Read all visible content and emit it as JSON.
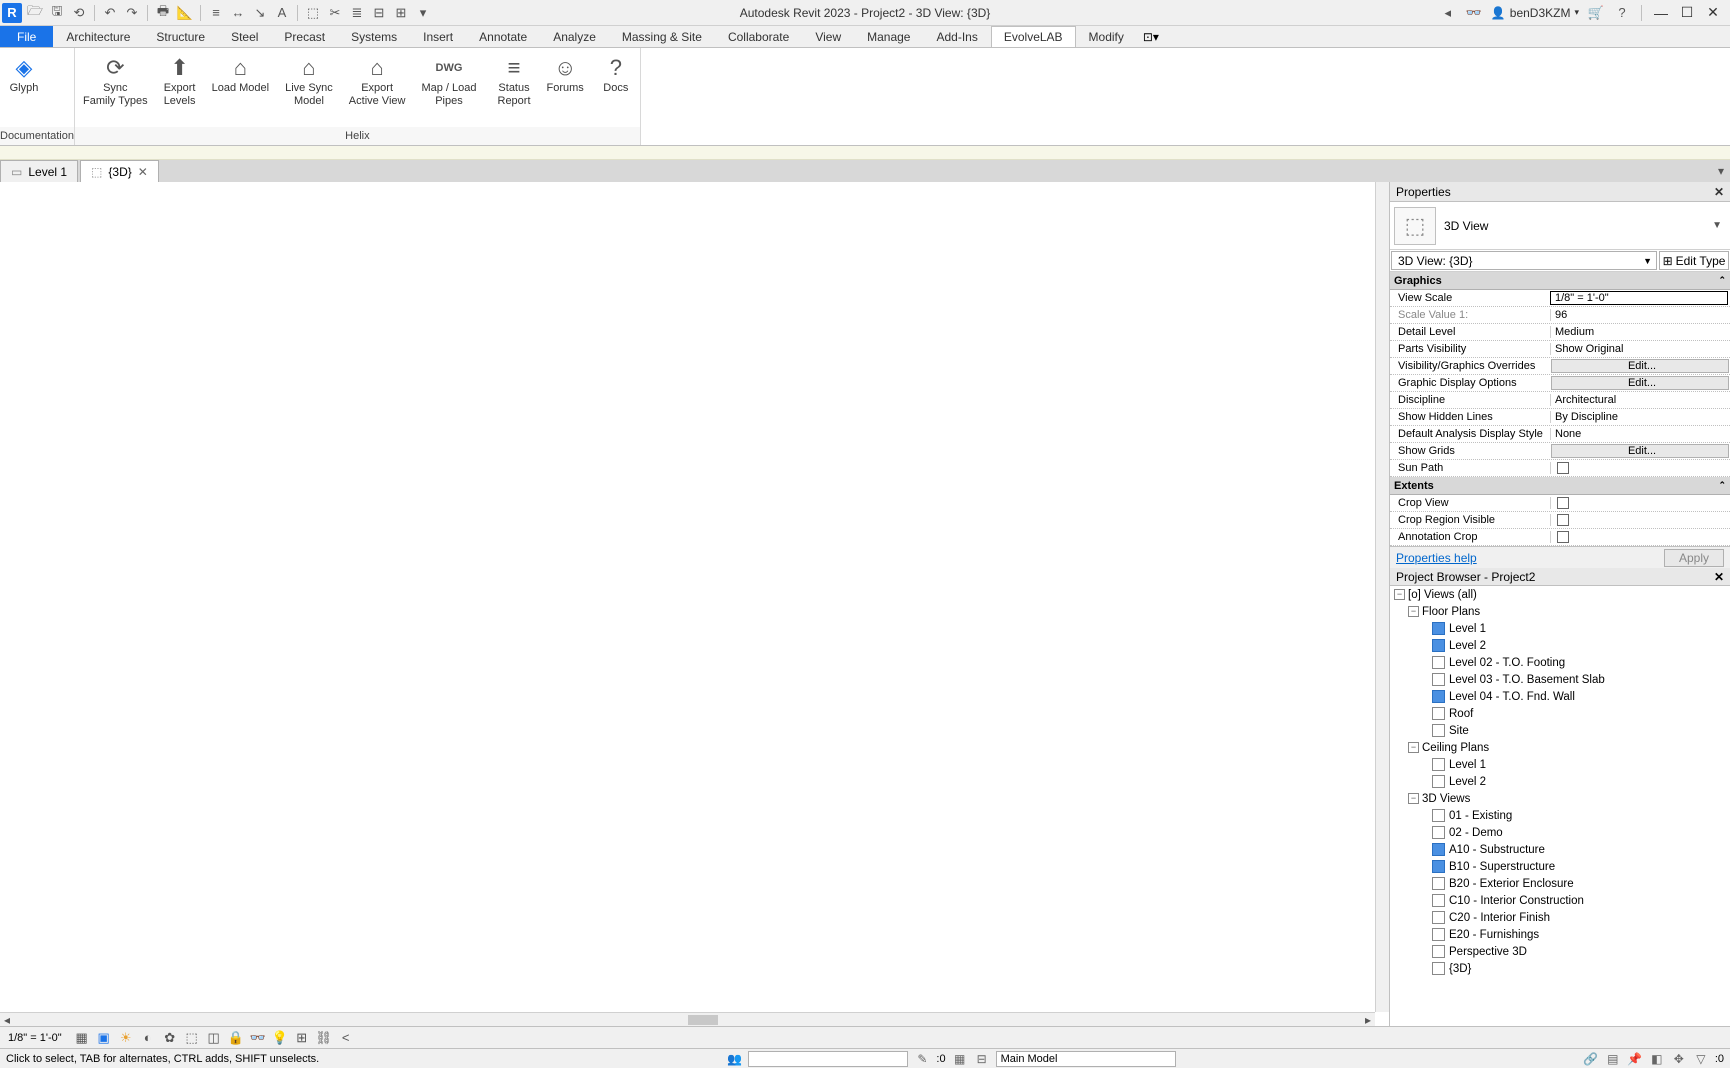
{
  "titlebar": {
    "app_title": "Autodesk Revit 2023 - Project2 - 3D View: {3D}",
    "username": "benD3KZM",
    "logo": "R"
  },
  "ribbon_tabs": {
    "file": "File",
    "items": [
      "Architecture",
      "Structure",
      "Steel",
      "Precast",
      "Systems",
      "Insert",
      "Annotate",
      "Analyze",
      "Massing & Site",
      "Collaborate",
      "View",
      "Manage",
      "Add-Ins",
      "EvolveLAB",
      "Modify"
    ],
    "active": "EvolveLAB"
  },
  "ribbon": {
    "panel1": {
      "label": "Documentation",
      "buttons": [
        {
          "lbl": "Glyph",
          "ico": "◈"
        }
      ]
    },
    "panel2": {
      "label": "",
      "buttons": [
        {
          "lbl": "Sync\nFamily Types",
          "ico": "⟳"
        },
        {
          "lbl": "Export\nLevels",
          "ico": "⬆"
        },
        {
          "lbl": "Load Model",
          "ico": "⌂"
        },
        {
          "lbl": "Live Sync\nModel",
          "ico": "⌂"
        },
        {
          "lbl": "Export\nActive View",
          "ico": "⌂"
        },
        {
          "lbl": "Map / Load\nPipes",
          "ico": "DWG"
        },
        {
          "lbl": "Status\nReport",
          "ico": "≡"
        },
        {
          "lbl": "Forums",
          "ico": "☺"
        },
        {
          "lbl": "Docs",
          "ico": "?"
        }
      ],
      "sublabel": "Helix"
    }
  },
  "view_tabs": {
    "tab1": "Level 1",
    "tab2": "{3D}"
  },
  "properties": {
    "title": "Properties",
    "type_name": "3D View",
    "selector": "3D View: {3D}",
    "edit_type": "Edit Type",
    "groups": {
      "graphics": "Graphics",
      "extents": "Extents"
    },
    "rows": {
      "view_scale": {
        "k": "View Scale",
        "v": "1/8\" = 1'-0\""
      },
      "scale_value": {
        "k": "Scale Value    1:",
        "v": "96"
      },
      "detail_level": {
        "k": "Detail Level",
        "v": "Medium"
      },
      "parts_vis": {
        "k": "Parts Visibility",
        "v": "Show Original"
      },
      "vg": {
        "k": "Visibility/Graphics Overrides",
        "v": "Edit..."
      },
      "gdo": {
        "k": "Graphic Display Options",
        "v": "Edit..."
      },
      "discipline": {
        "k": "Discipline",
        "v": "Architectural"
      },
      "hidden": {
        "k": "Show Hidden Lines",
        "v": "By Discipline"
      },
      "analysis": {
        "k": "Default Analysis Display Style",
        "v": "None"
      },
      "grids": {
        "k": "Show Grids",
        "v": "Edit..."
      },
      "sun": {
        "k": "Sun Path",
        "v": ""
      },
      "crop_view": {
        "k": "Crop View",
        "v": ""
      },
      "crop_region": {
        "k": "Crop Region Visible",
        "v": ""
      },
      "anno_crop": {
        "k": "Annotation Crop",
        "v": ""
      }
    },
    "help": "Properties help",
    "apply": "Apply"
  },
  "project_browser": {
    "title": "Project Browser - Project2",
    "views_all": "Views (all)",
    "floor_plans": "Floor Plans",
    "fp_items": [
      "Level 1",
      "Level 2",
      "Level 02 - T.O. Footing",
      "Level 03 - T.O. Basement Slab",
      "Level 04 - T.O. Fnd. Wall",
      "Roof",
      "Site"
    ],
    "ceiling_plans": "Ceiling Plans",
    "cp_items": [
      "Level 1",
      "Level 2"
    ],
    "threed": "3D Views",
    "td_items": [
      "01 - Existing",
      "02 - Demo",
      "A10 - Substructure",
      "B10 - Superstructure",
      "B20 - Exterior Enclosure",
      "C10 - Interior Construction",
      "C20 - Interior Finish",
      "E20 - Furnishings",
      "Perspective 3D",
      "{3D}"
    ]
  },
  "viewctrl": {
    "scale": "1/8\" = 1'-0\""
  },
  "statusbar": {
    "hint": "Click to select, TAB for alternates, CTRL adds, SHIFT unselects.",
    "filter_count": ":0",
    "main_model": "Main Model",
    "sel_count": ":0"
  }
}
